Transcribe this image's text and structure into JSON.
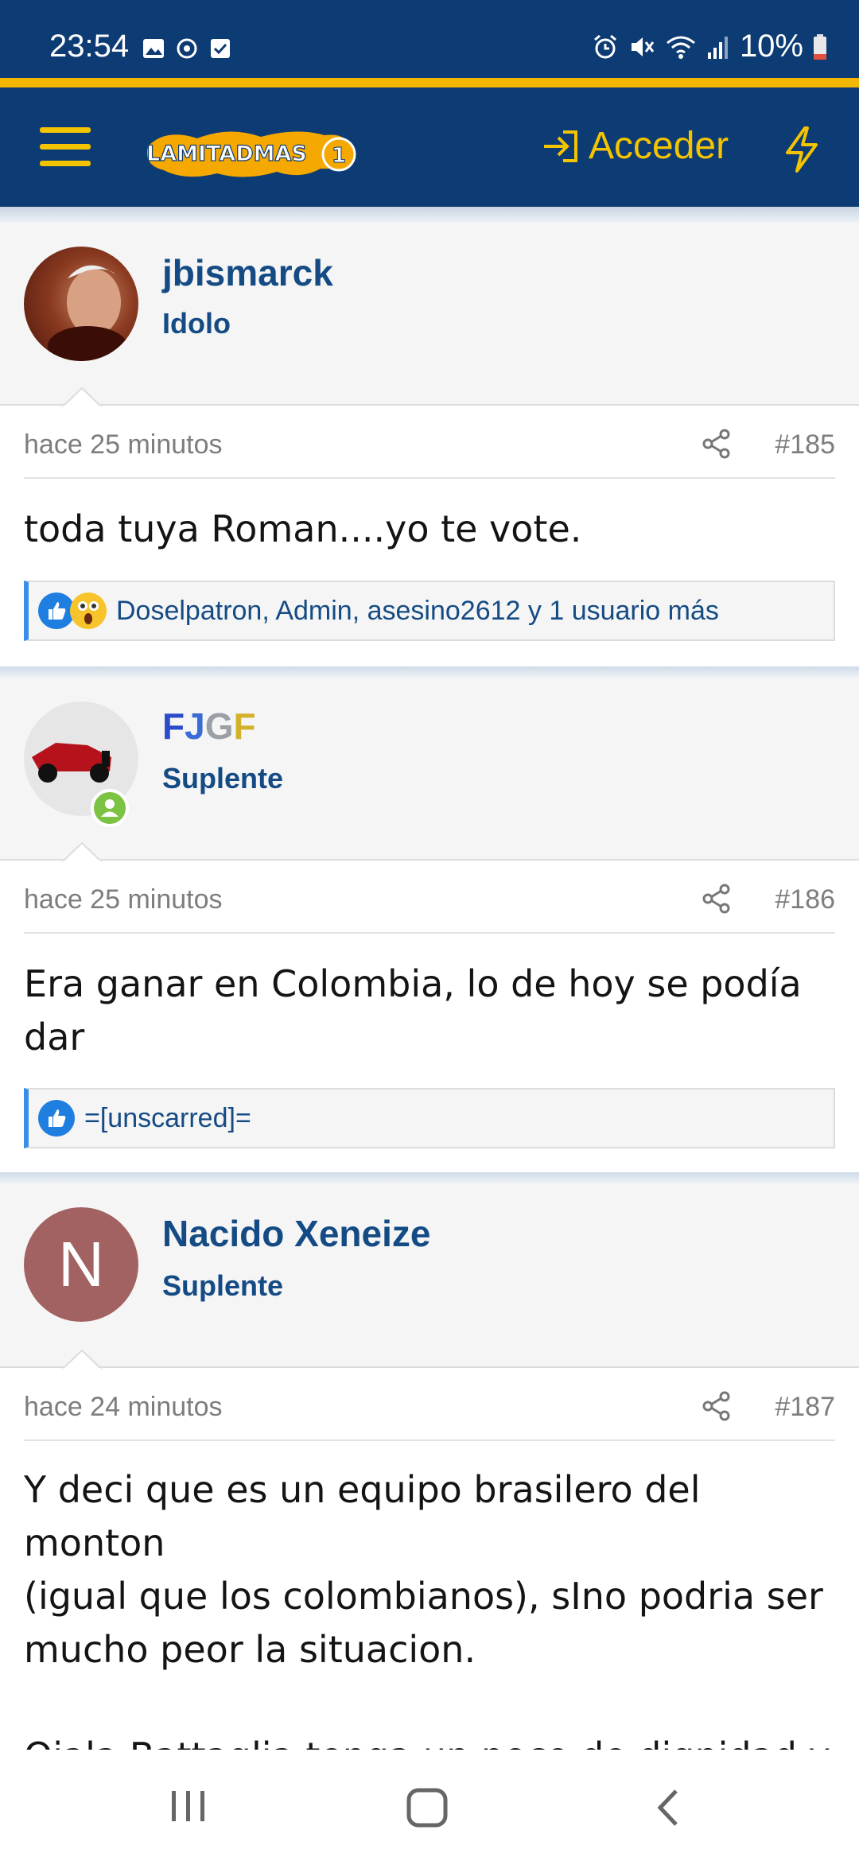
{
  "status_bar": {
    "time": "23:54",
    "battery": "10%",
    "left_icons": [
      "image-icon",
      "sync-icon",
      "checkbox-icon"
    ],
    "right_icons": [
      "alarm-icon",
      "mute-icon",
      "wifi-icon",
      "signal-icon",
      "battery-icon"
    ]
  },
  "header": {
    "logo_text": "LAMITADMAS1",
    "login_label": "Acceder",
    "colors": {
      "brand": "#0d3b73",
      "accent": "#f5c400"
    }
  },
  "posts": [
    {
      "username": "jbismarck",
      "role": "Idolo",
      "date": "hace 25 minutos",
      "number": "#185",
      "body": "toda tuya Roman....yo te vote.",
      "reactions": [
        "like",
        "wow"
      ],
      "reaction_users": "Doselpatron, Admin, asesino2612 y 1 usuario más"
    },
    {
      "username_letters": [
        "F",
        "J",
        "G",
        "F"
      ],
      "role": "Suplente",
      "date": "hace 25 minutos",
      "number": "#186",
      "body": "Era ganar en Colombia, lo de hoy se podía dar",
      "reactions": [
        "like"
      ],
      "reaction_users": "=[unscarred]="
    },
    {
      "username": "Nacido Xeneize",
      "avatar_letter": "N",
      "role": "Suplente",
      "date": "hace 24 minutos",
      "number": "#187",
      "body_lines": [
        "Y deci que es un equipo brasilero del monton",
        "(igual que los colombianos), sIno podria ser",
        "mucho peor la situacion.",
        "",
        "Ojala Battaglia tenga un poco de dignidad y"
      ]
    }
  ],
  "nav": {
    "items": [
      "recent-apps-icon",
      "home-icon",
      "back-icon"
    ]
  }
}
